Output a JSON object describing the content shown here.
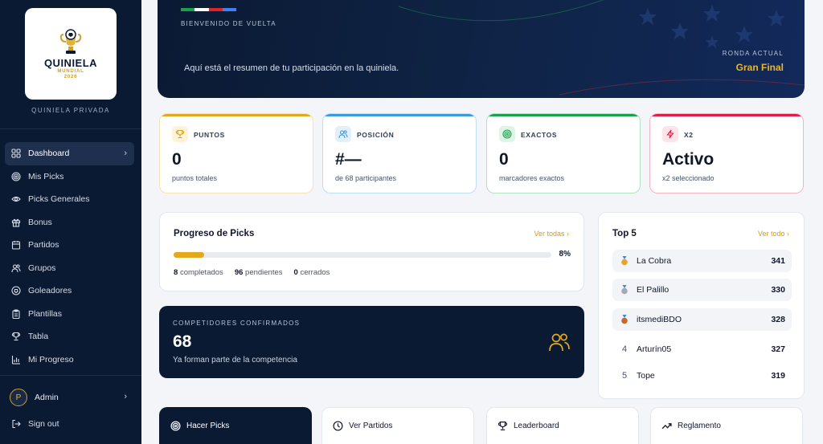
{
  "sidebar": {
    "logo": {
      "title": "QUINIELA",
      "subtitle": "MUNDIAL",
      "year": "2026"
    },
    "caption": "QUINIELA PRIVADA",
    "items": [
      {
        "label": "Dashboard",
        "icon": "grid-icon",
        "active": true
      },
      {
        "label": "Mis Picks",
        "icon": "target-icon"
      },
      {
        "label": "Picks Generales",
        "icon": "eye-icon"
      },
      {
        "label": "Bonus",
        "icon": "gift-icon"
      },
      {
        "label": "Partidos",
        "icon": "calendar-icon"
      },
      {
        "label": "Grupos",
        "icon": "users-icon"
      },
      {
        "label": "Goleadores",
        "icon": "ball-icon"
      },
      {
        "label": "Plantillas",
        "icon": "clipboard-icon"
      },
      {
        "label": "Tabla",
        "icon": "trophy-icon"
      },
      {
        "label": "Mi Progreso",
        "icon": "chart-icon"
      }
    ],
    "user": {
      "initial": "P",
      "name": "Admin"
    },
    "signout": "Sign out"
  },
  "hero": {
    "kicker": "BIENVENIDO DE VUELTA",
    "subtitle": "Aquí está el resumen de tu participación en la quiniela.",
    "round_label": "RONDA ACTUAL",
    "round_value": "Gran Final",
    "flag_colors": [
      "#16a34a",
      "#ffffff",
      "#dc2626",
      "#3b82f6"
    ]
  },
  "stats": [
    {
      "label": "PUNTOS",
      "value": "0",
      "desc": "puntos totales",
      "accent": "#e3a81c",
      "icon": "trophy-icon"
    },
    {
      "label": "POSICIÓN",
      "value": "#—",
      "desc": "de 68 participantes",
      "accent": "#3b9be0",
      "icon": "users-icon"
    },
    {
      "label": "EXACTOS",
      "value": "0",
      "desc": "marcadores exactos",
      "accent": "#16a34a",
      "icon": "target-icon"
    },
    {
      "label": "X2",
      "value": "Activo",
      "desc": "x2 seleccionado",
      "accent": "#e11d48",
      "icon": "bolt-icon"
    }
  ],
  "progress": {
    "title": "Progreso de Picks",
    "link": "Ver todas",
    "percent": 8,
    "percent_label": "8%",
    "completed": "8",
    "completed_label": "completados",
    "pending": "96",
    "pending_label": "pendientes",
    "closed": "0",
    "closed_label": "cerrados"
  },
  "competitors": {
    "kicker": "COMPETIDORES CONFIRMADOS",
    "value": "68",
    "subtitle": "Ya forman parte de la competencia"
  },
  "top5": {
    "title": "Top 5",
    "link": "Ver todo",
    "rows": [
      {
        "rank": "1",
        "medal": "gold",
        "name": "La Cobra",
        "points": "341"
      },
      {
        "rank": "2",
        "medal": "silver",
        "name": "El Palillo",
        "points": "330"
      },
      {
        "rank": "3",
        "medal": "bronze",
        "name": "itsmediBDO",
        "points": "328"
      },
      {
        "rank": "4",
        "medal": "",
        "name": "Arturín05",
        "points": "327"
      },
      {
        "rank": "5",
        "medal": "",
        "name": "Tope",
        "points": "319"
      }
    ]
  },
  "actions": [
    {
      "label": "Hacer Picks",
      "icon": "target-icon",
      "primary": true
    },
    {
      "label": "Ver Partidos",
      "icon": "clock-icon"
    },
    {
      "label": "Leaderboard",
      "icon": "trophy-icon"
    },
    {
      "label": "Reglamento",
      "icon": "trend-icon"
    }
  ]
}
